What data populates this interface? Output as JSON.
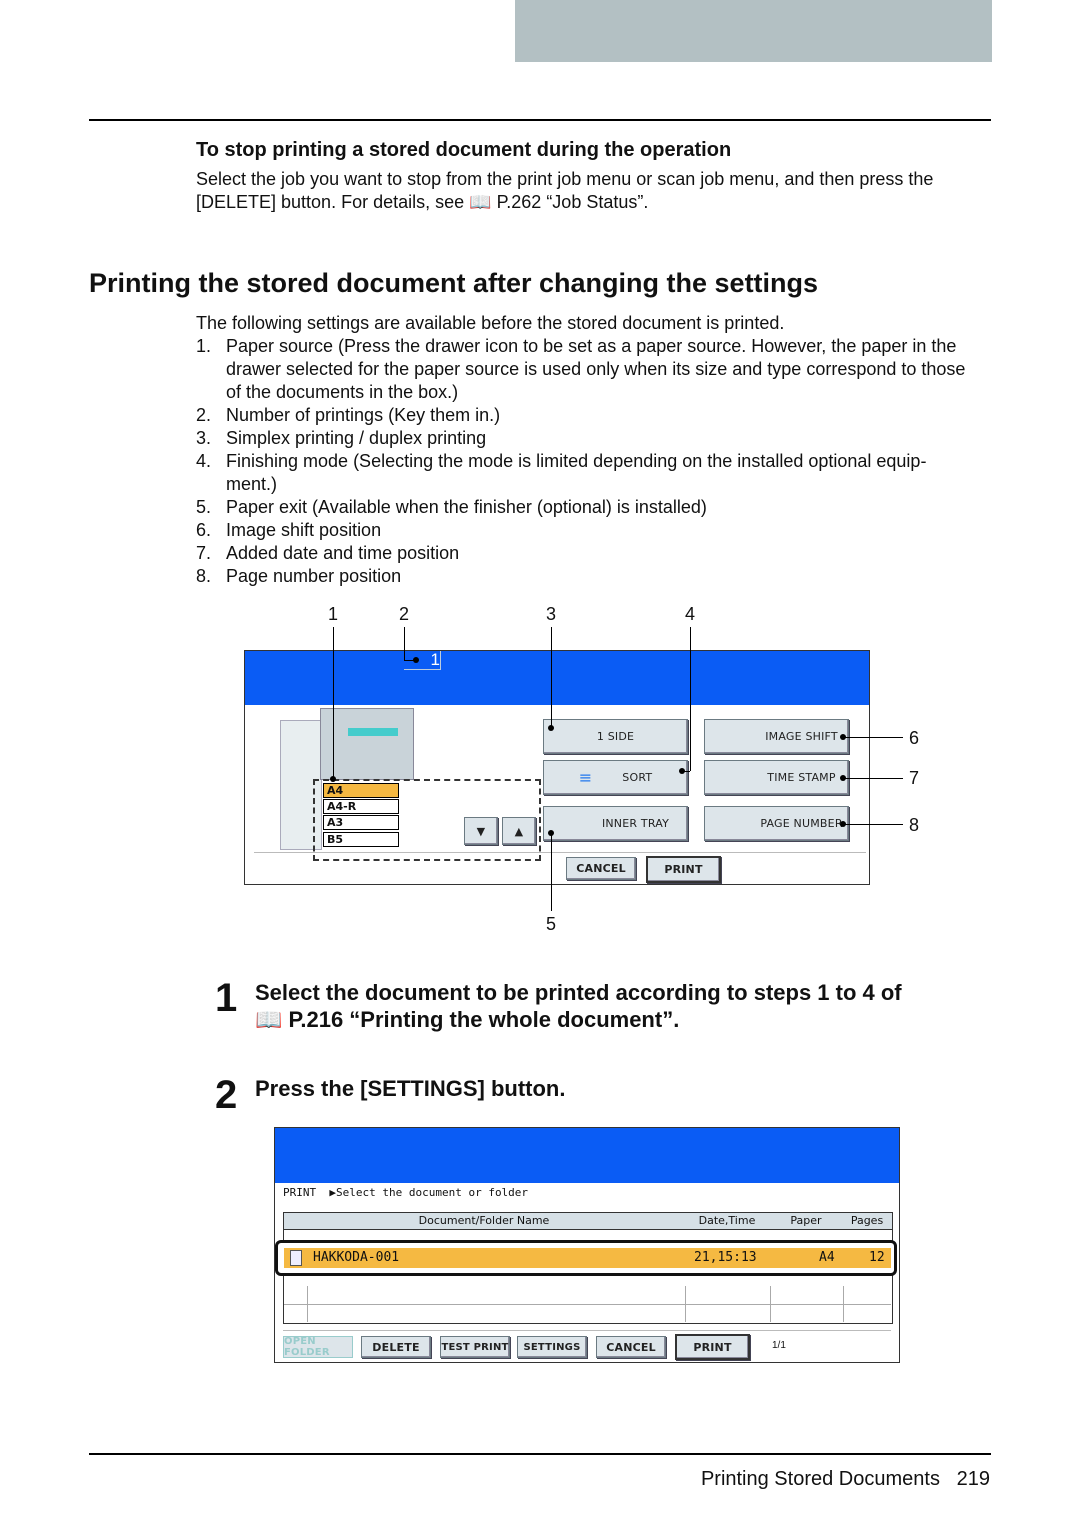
{
  "note": {
    "title": "To stop printing a stored document during the operation",
    "line1": "Select the job you want to stop from the print job menu or scan job menu, and then press the",
    "line2": "[DELETE] button. For details, see",
    "ref": "P.262 “Job Status”."
  },
  "section": {
    "title": "Printing the stored document after changing the settings",
    "intro": "The following settings are available before the stored document is printed.",
    "items": [
      {
        "n": "1.",
        "lines": [
          "Paper source (Press the drawer icon to be set as a paper source. However, the paper in the",
          "drawer selected for the paper source is used only when its size and type correspond to those",
          "of the documents in the box.)"
        ]
      },
      {
        "n": "2.",
        "lines": [
          "Number of printings (Key them in.)"
        ]
      },
      {
        "n": "3.",
        "lines": [
          "Simplex printing / duplex printing"
        ]
      },
      {
        "n": "4.",
        "lines": [
          "Finishing mode (Selecting the mode is limited depending on the installed optional equip-",
          "ment.)"
        ]
      },
      {
        "n": "5.",
        "lines": [
          "Paper exit (Available when the finisher (optional) is installed)"
        ]
      },
      {
        "n": "6.",
        "lines": [
          "Image shift position"
        ]
      },
      {
        "n": "7.",
        "lines": [
          "Added date and time position"
        ]
      },
      {
        "n": "8.",
        "lines": [
          "Page number position"
        ]
      }
    ]
  },
  "figure1": {
    "callouts": [
      "1",
      "2",
      "3",
      "4",
      "5",
      "6",
      "7",
      "8"
    ],
    "copies": "1",
    "trays": [
      "A4",
      "A4-R",
      "A3",
      "B5"
    ],
    "buttons": {
      "side": "1 SIDE",
      "sort": "SORT",
      "inner_tray": "INNER TRAY",
      "image_shift": "IMAGE SHIFT",
      "time_stamp": "TIME STAMP",
      "page_number": "PAGE NUMBER",
      "cancel": "CANCEL",
      "print": "PRINT"
    },
    "colors": {
      "header": "#0a5cf5",
      "selected": "#f5b942"
    }
  },
  "steps": [
    {
      "num": "1",
      "line1": "Select the document to be printed according to steps 1 to 4 of",
      "line2": "P.216 “Printing the whole document”."
    },
    {
      "num": "2",
      "line1": "Press the [SETTINGS] button."
    }
  ],
  "figure2": {
    "mode": "PRINT",
    "prompt": "▶Select the document or folder",
    "columns": [
      "Document/Folder Name",
      "Date,Time",
      "Paper",
      "Pages"
    ],
    "row": {
      "name": "HAKKODA-001",
      "date": "21,15:13",
      "paper": "A4",
      "pages": "12"
    },
    "buttons": {
      "open_folder": "OPEN FOLDER",
      "delete": "DELETE",
      "test_print": "TEST PRINT",
      "settings": "SETTINGS",
      "cancel": "CANCEL",
      "print": "PRINT"
    },
    "page": "1/1"
  },
  "footer": {
    "title": "Printing Stored Documents",
    "page": "219"
  }
}
